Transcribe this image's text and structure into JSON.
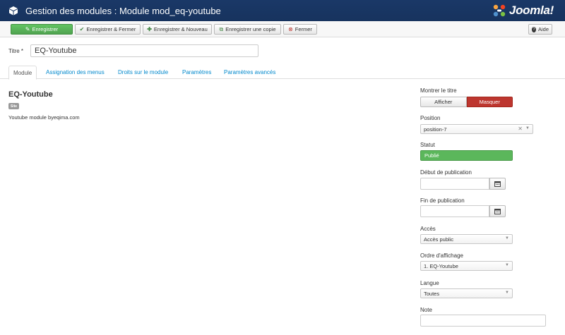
{
  "header": {
    "title": "Gestion des modules : Module mod_eq-youtube",
    "logo_text": "Joomla!"
  },
  "toolbar": {
    "save": "Enregistrer",
    "save_close": "Enregistrer & Fermer",
    "save_new": "Enregistrer & Nouveau",
    "save_copy": "Enregistrer une copie",
    "close": "Fermer",
    "help": "Aide"
  },
  "form": {
    "title_label": "Titre *",
    "title_value": "EQ-Youtube"
  },
  "tabs": [
    "Module",
    "Assignation des menus",
    "Droits sur le module",
    "Paramètres",
    "Paramètres avancés"
  ],
  "module": {
    "name": "EQ-Youtube",
    "badge": "Site",
    "description": "Youtube module byeqima.com"
  },
  "sidebar": {
    "show_title_label": "Montrer le titre",
    "show_option": "Afficher",
    "hide_option": "Masquer",
    "position_label": "Position",
    "position_value": "position-7",
    "status_label": "Statut",
    "status_value": "Publié",
    "publish_up_label": "Début de publication",
    "publish_down_label": "Fin de publication",
    "access_label": "Accès",
    "access_value": "Accès public",
    "ordering_label": "Ordre d'affichage",
    "ordering_value": "1. EQ-Youtube",
    "language_label": "Langue",
    "language_value": "Toutes",
    "note_label": "Note"
  },
  "colors": {
    "header_bg": "#1a3867",
    "save_green": "#51a351",
    "hide_red": "#bd362f",
    "published_green": "#5bb75b",
    "link_blue": "#0088cc"
  }
}
